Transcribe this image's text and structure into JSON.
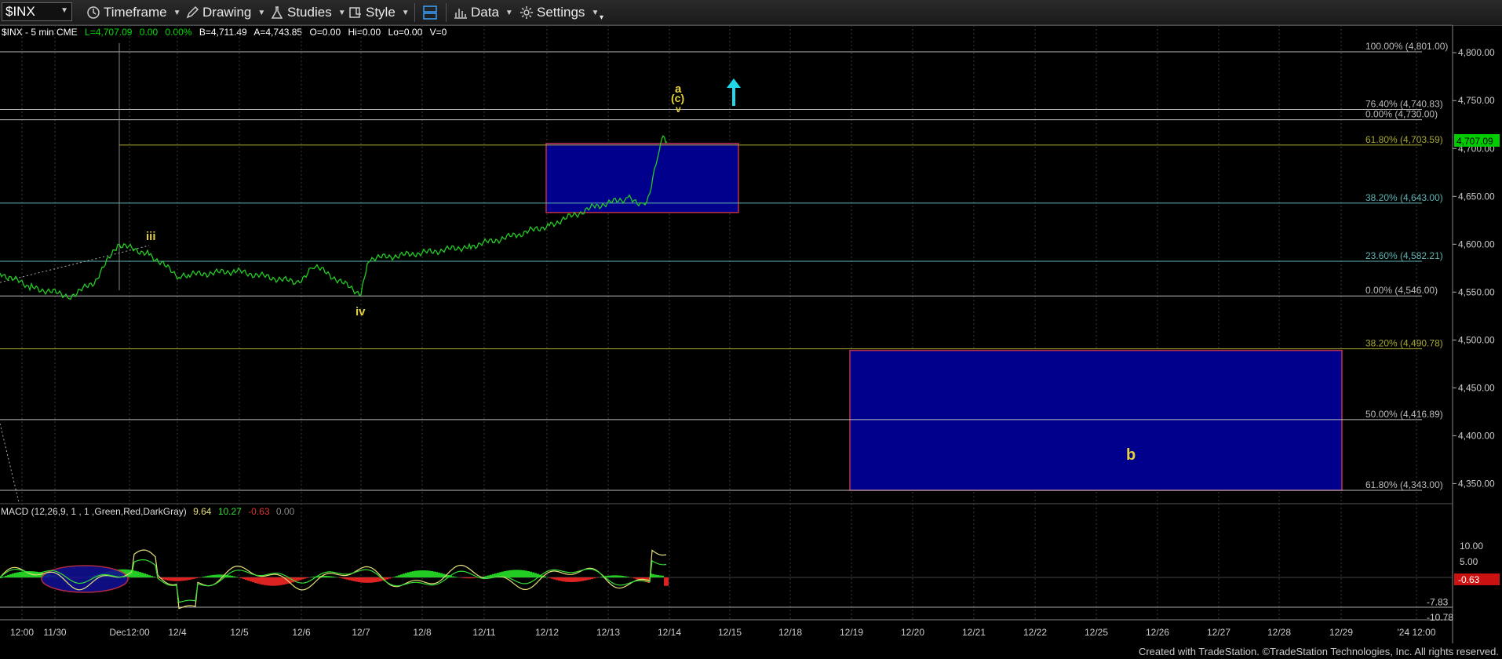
{
  "toolbar": {
    "symbol": "$INX",
    "timeframe": "Timeframe",
    "drawing": "Drawing",
    "studies": "Studies",
    "style": "Style",
    "data": "Data",
    "settings": "Settings"
  },
  "info": {
    "title": "$INX - 5 min  CME",
    "last": "L=4,707.09",
    "change": "0.00",
    "pct": "0.00%",
    "bid": "B=4,711.49",
    "ask": "A=4,743.85",
    "open": "O=0.00",
    "hi": "Hi=0.00",
    "lo": "Lo=0.00",
    "vol": "V=0"
  },
  "price_axis": {
    "ticks": [
      "4,800.00",
      "4,750.00",
      "4,700.00",
      "4,650.00",
      "4,600.00",
      "4,550.00",
      "4,500.00",
      "4,450.00",
      "4,400.00",
      "4,350.00"
    ],
    "last_price_label": "4,707.09",
    "last_price_color": "#00cc00"
  },
  "fib_levels": [
    {
      "label": "100.00% (4,801.00)",
      "price": 4801.0,
      "color": "#bbbbbb"
    },
    {
      "label": "76.40% (4,740.83)",
      "price": 4740.83,
      "color": "#bbbbbb"
    },
    {
      "label": "0.00% (4,730.00)",
      "price": 4730.0,
      "color": "#bbbbbb"
    },
    {
      "label": "61.80% (4,703.59)",
      "price": 4703.59,
      "color": "#a8a832"
    },
    {
      "label": "38.20% (4,643.00)",
      "price": 4643.0,
      "color": "#5fb3b3"
    },
    {
      "label": "23.60% (4,582.21)",
      "price": 4582.21,
      "color": "#5fb3b3"
    },
    {
      "label": "0.00% (4,546.00)",
      "price": 4546.0,
      "color": "#bbbbbb"
    },
    {
      "label": "38.20% (4,490.78)",
      "price": 4490.78,
      "color": "#a8a832"
    },
    {
      "label": "50.00% (4,416.89)",
      "price": 4416.89,
      "color": "#bbbbbb"
    },
    {
      "label": "61.80% (4,343.00)",
      "price": 4343.0,
      "color": "#bbbbbb"
    }
  ],
  "wave_labels": {
    "iii": "iii",
    "iv": "iv",
    "a": "a",
    "c": "(c)",
    "v": "v",
    "b": "b"
  },
  "macd": {
    "title": "MACD (12,26,9, 1 , 1 ,Green,Red,DarkGray)",
    "v1": "9.64",
    "v2": "10.27",
    "v3": "-0.63",
    "v4": "0.00",
    "ticks": [
      "10.00",
      "5.00",
      "-7.83",
      "-10.78"
    ],
    "current_label": "-0.63"
  },
  "x_axis": {
    "labels": [
      "12:00",
      "11/30",
      "Dec12:00",
      "12/4",
      "12/5",
      "12/6",
      "12/7",
      "12/8",
      "12/11",
      "12/12",
      "12/13",
      "12/14",
      "12/15",
      "12/18",
      "12/19",
      "12/20",
      "12/21",
      "12/22",
      "12/25",
      "12/26",
      "12/27",
      "12/28",
      "12/29",
      "'24 12:00"
    ]
  },
  "chart_data": {
    "type": "line",
    "title": "",
    "ylim": [
      4330,
      4825
    ],
    "series": [
      {
        "name": "",
        "y": [
          4570,
          4555,
          4546,
          4560,
          4600,
          4590,
          4565,
          4568,
          4572,
          4560,
          4578,
          4548,
          4585,
          4590,
          4598,
          4610,
          4620,
          4640,
          4648,
          4642,
          4652,
          4700,
          4710,
          4707
        ]
      }
    ],
    "rect_zones": [
      {
        "price_top": 4703.59,
        "price_bottom": 4643.0
      },
      {
        "price_top": 4490.78,
        "price_bottom": 4343.0
      }
    ]
  },
  "footer": "Created with TradeStation. ©TradeStation Technologies, Inc. All rights reserved."
}
